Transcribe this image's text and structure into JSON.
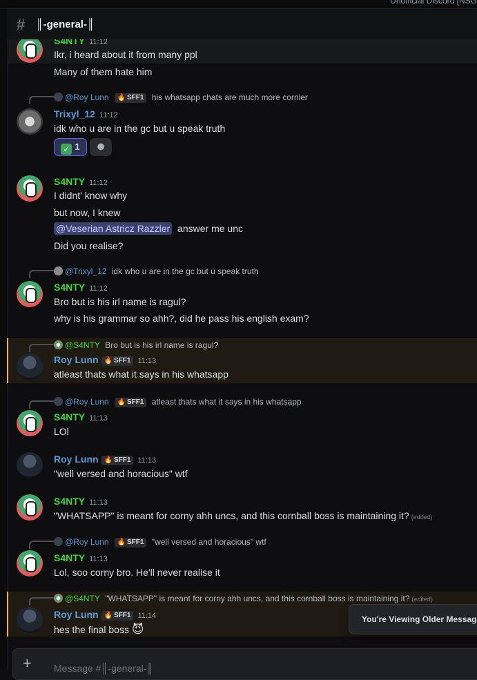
{
  "top_strip": {
    "server_text": "Unofficial Discord [NSG"
  },
  "channel": {
    "name": "║-general-║"
  },
  "messages": [
    {
      "author": "S4NTY",
      "time": "11:12",
      "lines": [
        "Ikr, i heard about it from many ppl",
        "Many of them hate him"
      ]
    },
    {
      "reply": {
        "name": "@Roy Lunn",
        "tag": "SFF1",
        "text": "his whatsapp chats are much more cornier"
      },
      "author": "Trixyl_12",
      "time": "11:12",
      "lines": [
        "idk who u are in the gc but u speak truth"
      ],
      "reactions": {
        "emoji_count": "1"
      }
    },
    {
      "author": "S4NTY",
      "time": "11:12",
      "lines": [
        "I didnt' know why",
        "but now, I knew",
        "answer me unc",
        "Did you realise?"
      ],
      "mention": "@Veserian Astricz Razzler"
    },
    {
      "reply": {
        "name": "@Trixyl_12",
        "text": "idk who u are in the gc but u speak truth"
      },
      "author": "S4NTY",
      "time": "11:12",
      "lines": [
        "Bro but is his irl name is ragul?",
        "why is his grammar so ahh?, did he pass his english exam?"
      ]
    },
    {
      "reply": {
        "name": "@S4NTY",
        "text": "Bro but is his irl name is ragul?"
      },
      "author": "Roy Lunn",
      "tag": "SFF1",
      "time": "11:13",
      "lines": [
        "atleast thats what it says in his whatsapp"
      ]
    },
    {
      "reply": {
        "name": "@Roy Lunn",
        "tag": "SFF1",
        "text": "atleast thats what it says in his whatsapp"
      },
      "author": "S4NTY",
      "time": "11:13",
      "lines": [
        "LOl"
      ]
    },
    {
      "author": "Roy Lunn",
      "tag": "SFF1",
      "time": "11:13",
      "lines": [
        "\"well versed and horacious\" wtf"
      ]
    },
    {
      "author": "S4NTY",
      "time": "11:13",
      "lines": [
        "\"WHATSAPP\" is meant for corny ahh uncs, and this cornball boss is maintaining it?"
      ],
      "edited": "(edited)"
    },
    {
      "reply": {
        "name": "@Roy Lunn",
        "tag": "SFF1",
        "text": "\"well versed and horacious\" wtf"
      },
      "author": "S4NTY",
      "time": "11:13",
      "lines": [
        "Lol, soo corny bro. He'll never realise it"
      ]
    },
    {
      "reply": {
        "name": "@S4NTY",
        "text": "\"WHATSAPP\" is meant for corny ahh uncs, and this cornball boss is maintaining it?",
        "edited": "(edited)"
      },
      "author": "Roy Lunn",
      "tag": "SFF1",
      "time": "11:14",
      "lines": [
        "hes the final boss"
      ],
      "emoji": "😈"
    }
  ],
  "toast": "You're Viewing Older Messages",
  "composer": {
    "placeholder": "Message #║-general-║"
  },
  "colors": {
    "santy_name": "#3ed63e",
    "blue_name": "#5b9bd5",
    "mention_bg": "#1f1b12",
    "mention_border": "#f0b232"
  }
}
